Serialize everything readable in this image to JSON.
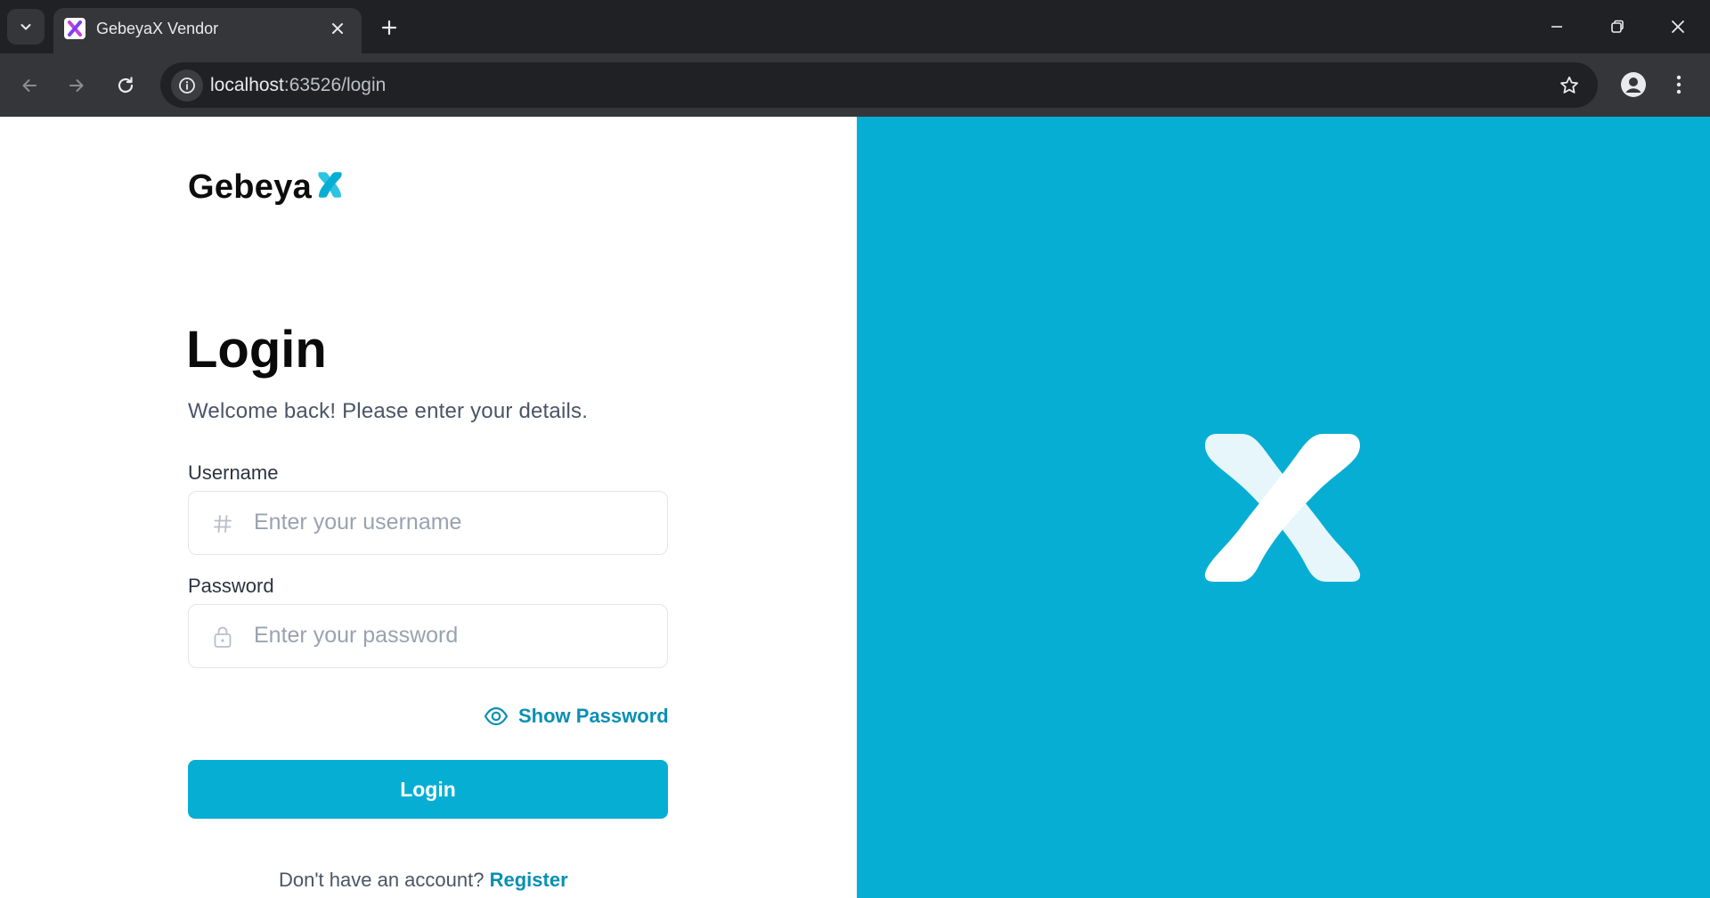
{
  "browser": {
    "tab_title": "GebeyaX Vendor",
    "url_host": "localhost",
    "url_path": ":63526/login"
  },
  "brand": {
    "name": "Gebeya",
    "accent_color": "#07aed4"
  },
  "login": {
    "heading": "Login",
    "subtitle": "Welcome back! Please enter your details.",
    "username": {
      "label": "Username",
      "placeholder": "Enter your username",
      "value": "",
      "icon": "hash-icon"
    },
    "password": {
      "label": "Password",
      "placeholder": "Enter your password",
      "value": "",
      "icon": "lock-icon"
    },
    "show_password_label": "Show Password",
    "submit_label": "Login",
    "register_prompt": "Don't have an account?",
    "register_link": "Register"
  },
  "colors": {
    "primary": "#07aed4",
    "link": "#0a8fb3",
    "panel": "#07aed4"
  }
}
